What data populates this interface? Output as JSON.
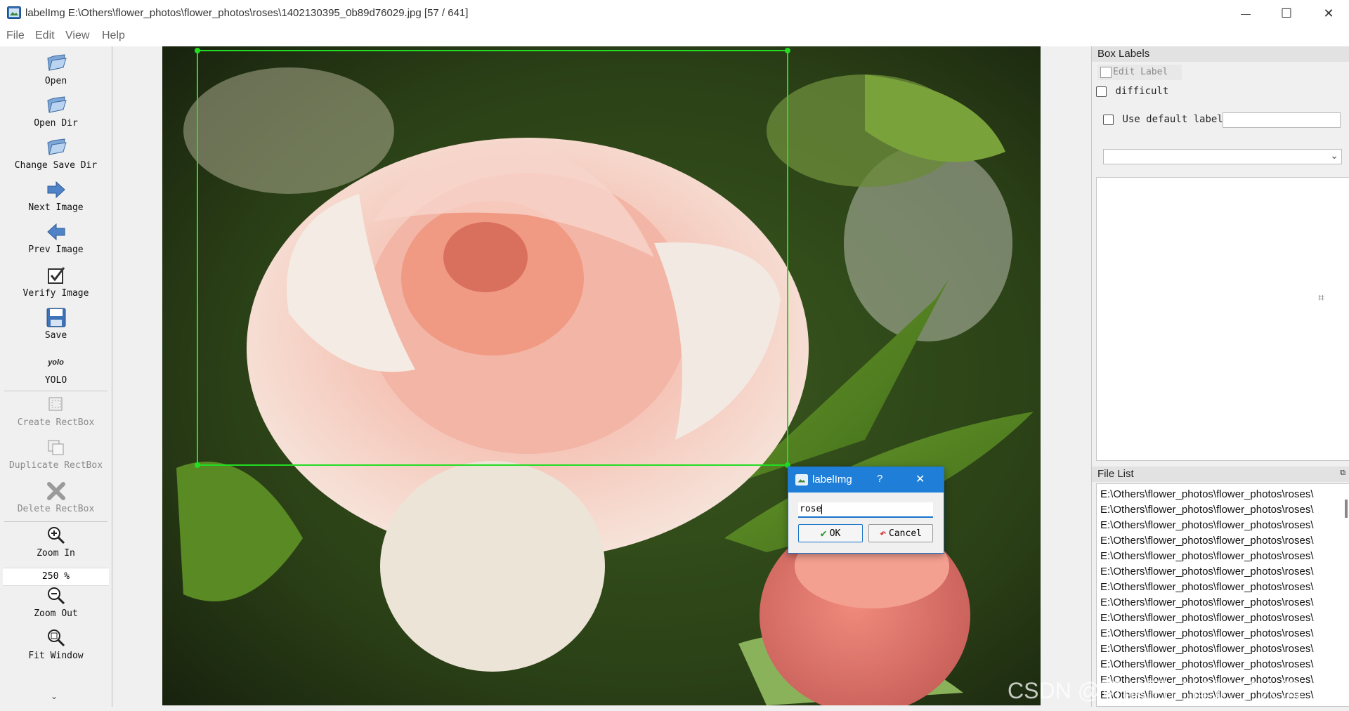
{
  "window": {
    "title": "labelImg E:\\Others\\flower_photos\\flower_photos\\roses\\1402130395_0b89d76029.jpg [57 / 641]",
    "controls": {
      "minimize": "—",
      "maximize": "☐",
      "close": "✕"
    }
  },
  "menu": [
    "File",
    "Edit",
    "View",
    "Help"
  ],
  "toolbar": {
    "open": "Open",
    "open_dir": "Open Dir",
    "change_save_dir": "Change Save Dir",
    "next_image": "Next Image",
    "prev_image": "Prev Image",
    "verify_image": "Verify Image",
    "save": "Save",
    "yolo_icon_text": "yolo",
    "yolo": "YOLO",
    "create_rectbox": "Create RectBox",
    "duplicate_rectbox": "Duplicate RectBox",
    "delete_rectbox": "Delete RectBox",
    "zoom_in": "Zoom In",
    "zoom_value": "250 %",
    "zoom_out": "Zoom Out",
    "fit_window": "Fit Window",
    "more": "⌄"
  },
  "dock": {
    "box_labels_title": "Box Labels",
    "edit_label": "Edit Label",
    "difficult": "difficult",
    "use_default_label": "Use default label",
    "default_label_value": "",
    "file_list_title": "File List",
    "file_list_items": [
      "E:\\Others\\flower_photos\\flower_photos\\roses\\",
      "E:\\Others\\flower_photos\\flower_photos\\roses\\",
      "E:\\Others\\flower_photos\\flower_photos\\roses\\",
      "E:\\Others\\flower_photos\\flower_photos\\roses\\",
      "E:\\Others\\flower_photos\\flower_photos\\roses\\",
      "E:\\Others\\flower_photos\\flower_photos\\roses\\",
      "E:\\Others\\flower_photos\\flower_photos\\roses\\",
      "E:\\Others\\flower_photos\\flower_photos\\roses\\",
      "E:\\Others\\flower_photos\\flower_photos\\roses\\",
      "E:\\Others\\flower_photos\\flower_photos\\roses\\",
      "E:\\Others\\flower_photos\\flower_photos\\roses\\",
      "E:\\Others\\flower_photos\\flower_photos\\roses\\",
      "E:\\Others\\flower_photos\\flower_photos\\roses\\",
      "E:\\Others\\flower_photos\\flower_photos\\roses\\"
    ]
  },
  "dialog": {
    "title": "labelImg",
    "help": "?",
    "close": "✕",
    "input_value": "rose",
    "ok": "OK",
    "cancel": "Cancel"
  },
  "watermark": "CSDN @可能回忆掉进了大海",
  "colors": {
    "bbox": "#22dd22",
    "dialog_titlebar": "#1f7fd8"
  }
}
